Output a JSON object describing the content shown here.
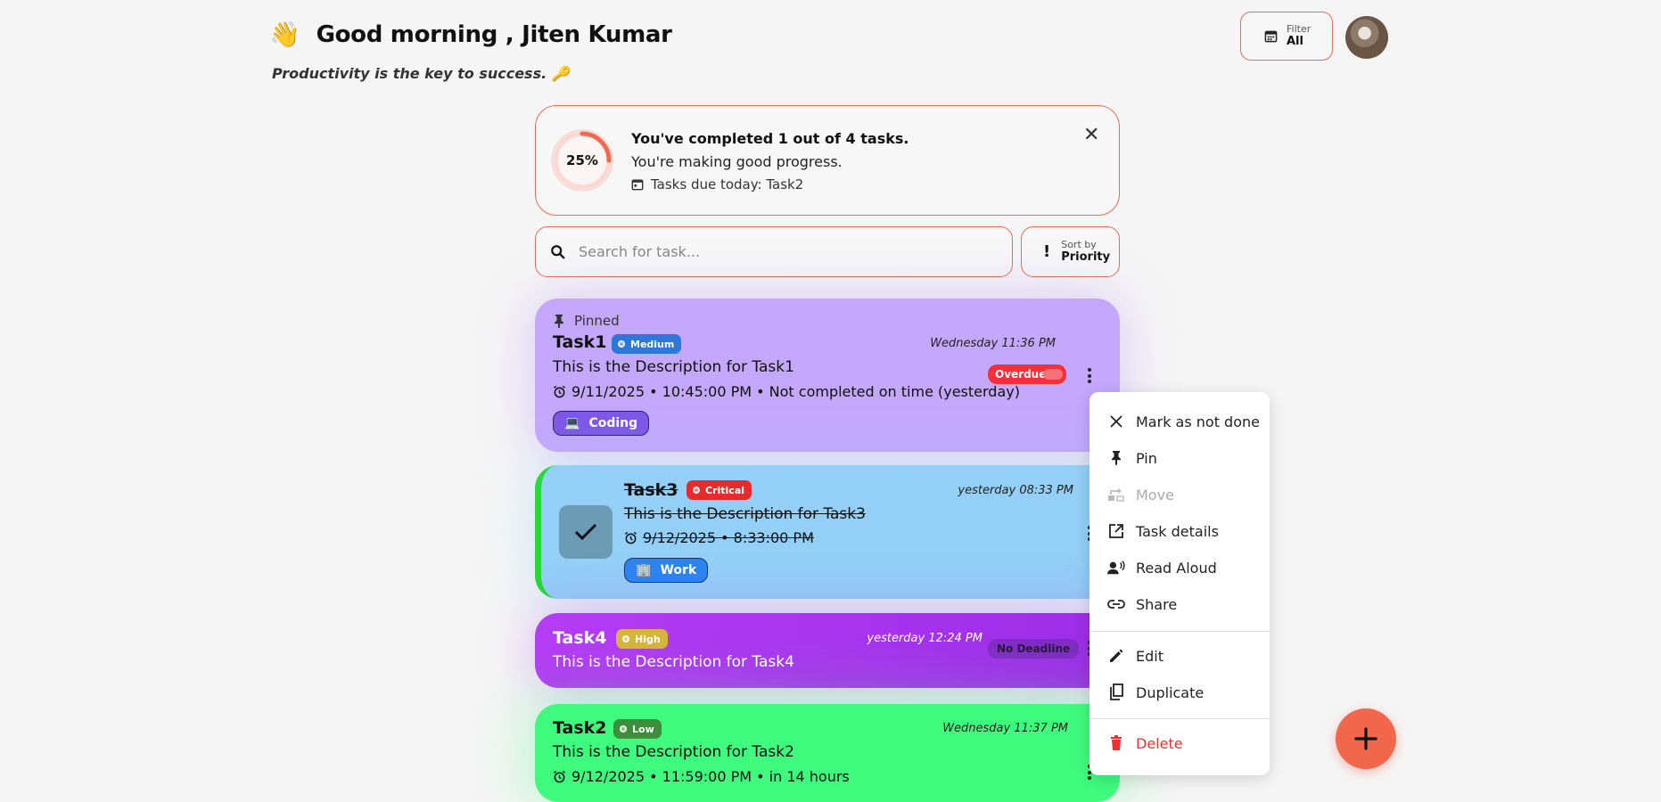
{
  "header": {
    "wave_emoji": "👋",
    "greeting": "Good morning , Jiten Kumar",
    "quote": "Productivity is the key to success. 🔑",
    "filter": {
      "label": "Filter",
      "value": "All"
    }
  },
  "progress": {
    "percent_label": "25%",
    "percent_value": 0.25,
    "title": "You've completed 1 out of 4 tasks.",
    "subtitle": "You're making good progress.",
    "due_today": "Tasks due today: Task2",
    "accent": "#ef6a53"
  },
  "search": {
    "placeholder": "Search for task..."
  },
  "sort": {
    "label": "Sort by",
    "value": "Priority"
  },
  "tasks": [
    {
      "pinned_label": "Pinned",
      "name": "Task1",
      "priority": "Medium",
      "created": "Wednesday 11:36 PM",
      "description": "This is the Description for Task1",
      "deadline": "9/11/2025 • 10:45:00 PM • Not completed on time (yesterday)",
      "status": "Overdue",
      "category": {
        "emoji": "💻",
        "label": "Coding"
      },
      "color": "#c4a8fb"
    },
    {
      "name": "Task3",
      "priority": "Critical",
      "created": "yesterday 08:33 PM",
      "description": "This is the Description for Task3",
      "deadline": "9/12/2025 • 8:33:00 PM",
      "done": true,
      "category": {
        "emoji": "🏢",
        "label": "Work"
      },
      "color": "#93cff6"
    },
    {
      "name": "Task4",
      "priority": "High",
      "created": "yesterday 12:24 PM",
      "description": "This is the Description for Task4",
      "status": "No Deadline",
      "color": "#b53cf5"
    },
    {
      "name": "Task2",
      "priority": "Low",
      "created": "Wednesday 11:37 PM",
      "description": "This is the Description for Task2",
      "deadline": "9/12/2025 • 11:59:00 PM • in 14 hours",
      "color": "#3efb7e"
    }
  ],
  "menu": {
    "items": [
      {
        "label": "Mark as not done",
        "icon": "close-icon"
      },
      {
        "label": "Pin",
        "icon": "pin-icon"
      },
      {
        "label": "Move",
        "icon": "move-icon",
        "disabled": true
      },
      {
        "label": "Task details",
        "icon": "open-in-new-icon"
      },
      {
        "label": "Read Aloud",
        "icon": "record-voice-icon"
      },
      {
        "label": "Share",
        "icon": "link-icon"
      },
      {
        "label": "Edit",
        "icon": "edit-icon"
      },
      {
        "label": "Duplicate",
        "icon": "copy-icon"
      },
      {
        "label": "Delete",
        "icon": "trash-icon",
        "danger": true
      }
    ]
  },
  "fab": {
    "icon": "plus-icon"
  }
}
